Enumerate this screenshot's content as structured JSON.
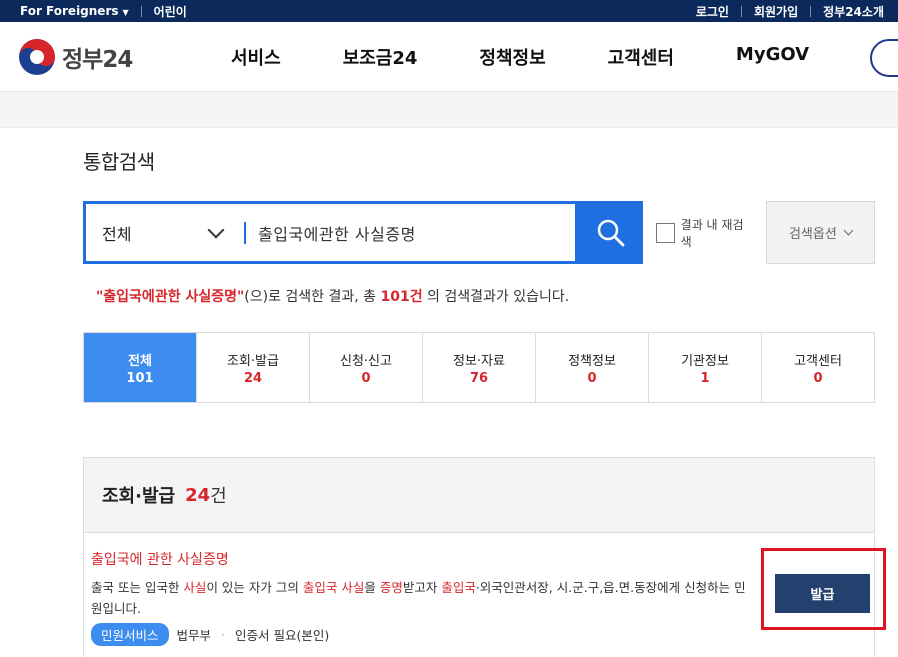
{
  "util_bar": {
    "foreigners": "For Foreigners",
    "kids": "어린이",
    "login": "로그인",
    "signup": "회원가입",
    "about": "정부24소개"
  },
  "header": {
    "logo_text": "정부24",
    "nav": [
      "서비스",
      "보조금24",
      "정책정보",
      "고객센터",
      "MyGOV"
    ]
  },
  "page_title": "통합검색",
  "search": {
    "scope_selected": "전체",
    "query": "출입국에관한 사실증명",
    "recheck_label": "결과 내 재검색",
    "options_label": "검색옵션"
  },
  "result_summary": {
    "query_quoted": "\"출입국에관한 사실증명\"",
    "text_mid": "(으)로 검색한 결과, 총 ",
    "count": "101건",
    "text_end": " 의 검색결과가 있습니다."
  },
  "tabs": [
    {
      "label": "전체",
      "count": "101"
    },
    {
      "label": "조회·발급",
      "count": "24"
    },
    {
      "label": "신청·신고",
      "count": "0"
    },
    {
      "label": "정보·자료",
      "count": "76"
    },
    {
      "label": "정책정보",
      "count": "0"
    },
    {
      "label": "기관정보",
      "count": "1"
    },
    {
      "label": "고객센터",
      "count": "0"
    }
  ],
  "section": {
    "title": "조회·발급",
    "count": "24",
    "unit": "건"
  },
  "item": {
    "title": "출입국에 관한 사실증명",
    "desc_parts": [
      "출국 또는 입국한 ",
      "사실",
      "이 있는 자가 그의 ",
      "출입국 사실",
      "을 ",
      "증명",
      "받고자 ",
      "출입국",
      "·외국인관서장, 시.군.구,읍.면.동장에게 신청하는 민원입니다."
    ],
    "badge": "민원서비스",
    "agency": "법무부",
    "cert": "인증서 필요(본인)",
    "action_label": "발급"
  },
  "colors": {
    "accent": "#1f6fe0",
    "tab_active": "#3d8cf0",
    "highlight_red": "#d7262b",
    "issue_button": "#23406f",
    "top_bar": "#0b2a5b"
  }
}
